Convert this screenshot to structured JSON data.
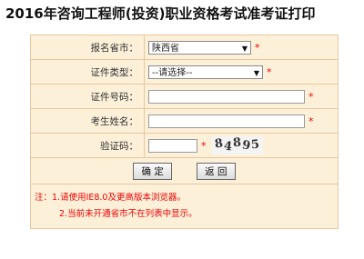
{
  "page": {
    "title": "2016年咨询工程师(投资)职业资格考试准考证打印"
  },
  "form": {
    "province": {
      "label": "报名省市：",
      "value": "陕西省"
    },
    "id_type": {
      "label": "证件类型：",
      "value": "--请选择--"
    },
    "id_number": {
      "label": "证件号码：",
      "value": ""
    },
    "name": {
      "label": "考生姓名：",
      "value": ""
    },
    "captcha": {
      "label": "验证码：",
      "value": "",
      "image_text": "84895"
    },
    "required_mark": "*"
  },
  "buttons": {
    "confirm": "确 定",
    "back": "返 回"
  },
  "notes": {
    "line1": "注：1.请使用IE8.0及更高版本浏览器。",
    "line2": "2.当前未开通省市不在列表中显示。"
  }
}
